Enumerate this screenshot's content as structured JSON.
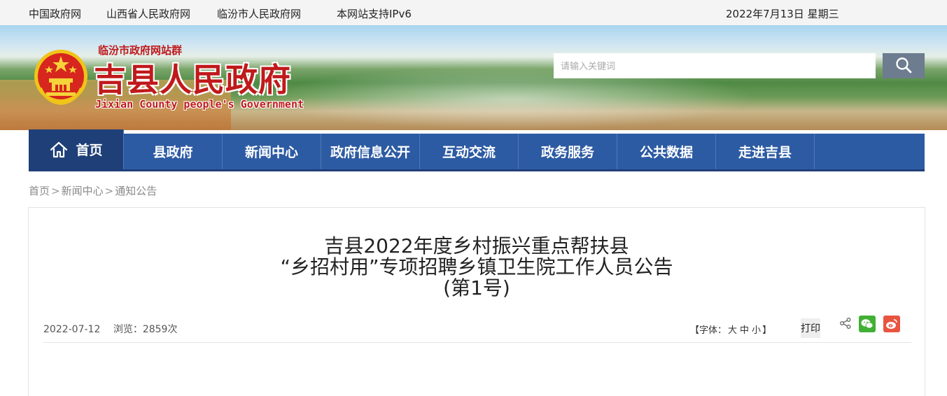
{
  "topbar": {
    "links": [
      "中国政府网",
      "山西省人民政府网",
      "临汾市人民政府网",
      "本网站支持IPv6"
    ],
    "date": "2022年7月13日 星期三"
  },
  "banner": {
    "site_group": "临汾市政府网站群",
    "site_title": "吉县人民政府",
    "site_title_en": "Jixian County people's Government",
    "search_placeholder": "请输入关键词"
  },
  "nav": {
    "items": [
      "首页",
      "县政府",
      "新闻中心",
      "政府信息公开",
      "互动交流",
      "政务服务",
      "公共数据",
      "走进吉县"
    ]
  },
  "breadcrumb": {
    "items": [
      "首页",
      "新闻中心",
      "通知公告"
    ],
    "separator": ">"
  },
  "article": {
    "title_lines": [
      "吉县2022年度乡村振兴重点帮扶县",
      "“乡招村用”专项招聘乡镇卫生院工作人员公告",
      "(第1号)"
    ],
    "date": "2022-07-12",
    "views_label": "浏览：2859次",
    "font_size_prefix": "【字体：",
    "font_large": "大",
    "font_medium": "中",
    "font_small": "小",
    "font_size_suffix": "】",
    "print_label": "打印"
  },
  "colors": {
    "nav_bg": "#2d5ba3",
    "nav_active": "#1f3f78",
    "brand_red": "#c0191b",
    "wechat": "#41b035",
    "weibo": "#e8543f"
  }
}
